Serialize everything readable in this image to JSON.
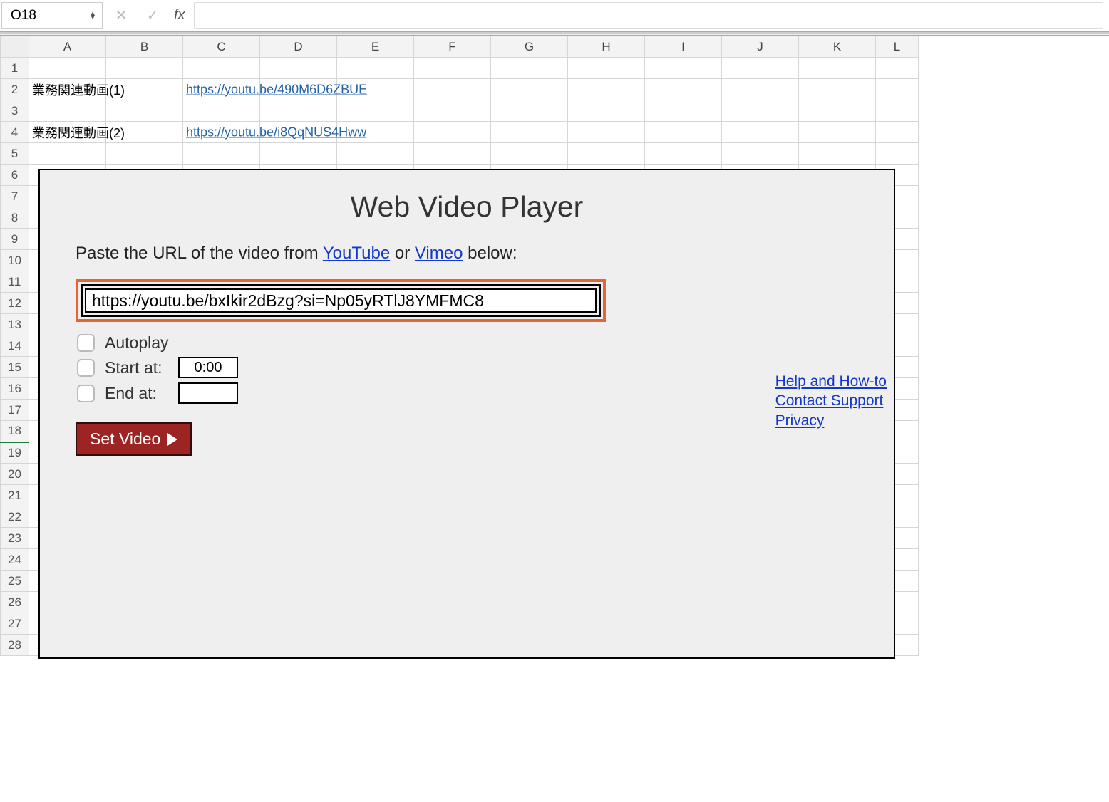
{
  "formula_bar": {
    "name_box": "O18",
    "fx_label": "fx",
    "cancel_glyph": "✕",
    "confirm_glyph": "✓",
    "formula_value": ""
  },
  "columns": [
    "A",
    "B",
    "C",
    "D",
    "E",
    "F",
    "G",
    "H",
    "I",
    "J",
    "K",
    "L"
  ],
  "rows": [
    1,
    2,
    3,
    4,
    5,
    6,
    7,
    8,
    9,
    10,
    11,
    12,
    13,
    14,
    15,
    16,
    17,
    18,
    19,
    20,
    21,
    22,
    23,
    24,
    25,
    26,
    27,
    28
  ],
  "active_row": 18,
  "cells": {
    "A2": "業務関連動画(1)",
    "C2": "https://youtu.be/490M6D6ZBUE",
    "A4": "業務関連動画(2)",
    "C4": "https://youtu.be/i8QqNUS4Hww"
  },
  "taskpane": {
    "title": "Web Video Player",
    "instruction_pre": "Paste the URL of the video from ",
    "link_youtube": "YouTube",
    "instruction_or": " or ",
    "link_vimeo": "Vimeo",
    "instruction_post": " below:",
    "url_value": "https://youtu.be/bxIkir2dBzg?si=Np05yRTlJ8YMFMC8",
    "autoplay_label": "Autoplay",
    "start_label": "Start at:",
    "start_value": "0:00",
    "end_label": "End at:",
    "end_value": "",
    "set_button": "Set Video",
    "help_link": "Help and How-to",
    "support_link": "Contact Support",
    "privacy_link": "Privacy"
  }
}
